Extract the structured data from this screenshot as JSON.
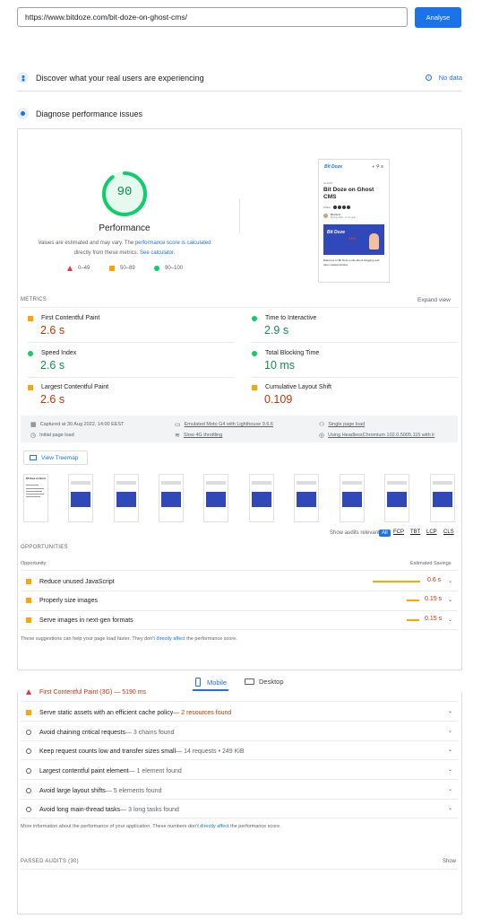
{
  "url_bar": {
    "value": "https://www.bitdoze.com/bit-doze-on-ghost-cms/",
    "button": "Analyse"
  },
  "field_data": {
    "title": "Discover what your real users are experiencing",
    "status": "No data"
  },
  "lab": {
    "title": "Diagnose performance issues"
  },
  "score": {
    "value": "90",
    "fraction": 0.9,
    "label": "Performance",
    "note_pre": "Values are estimated and may vary. The ",
    "note_link1": "performance score is calculated",
    "note_mid": " directly from these metrics. ",
    "note_link2": "See calculator.",
    "legend": [
      "0–49",
      "50–89",
      "90–100"
    ],
    "color": "#0cce6b"
  },
  "preview": {
    "brand": "Bit Doze",
    "tag": "GHOST",
    "title": "Bit Doze on Ghost CMS",
    "share": "Share",
    "author": "Bit Doze",
    "meta": "28 Aug 2022 · 3 min read",
    "hero": "Bit Doze",
    "hero_sub": "CMS",
    "body": "Welcome to Bit Doze a site about blogging and other related articles."
  },
  "metrics": {
    "header": "METRICS",
    "expand": "Expand view",
    "items": [
      {
        "name": "First Contentful Paint",
        "value": "2.6 s",
        "status": "average"
      },
      {
        "name": "Time to Interactive",
        "value": "2.9 s",
        "status": "good"
      },
      {
        "name": "Speed Index",
        "value": "2.6 s",
        "status": "good"
      },
      {
        "name": "Total Blocking Time",
        "value": "10 ms",
        "status": "good"
      },
      {
        "name": "Largest Contentful Paint",
        "value": "2.6 s",
        "status": "average"
      },
      {
        "name": "Cumulative Layout Shift",
        "value": "0.109",
        "status": "average"
      }
    ]
  },
  "runtime": {
    "captured": "Captured at 30 Aug 2022, 14:00 EEST",
    "initial": "Initial page load",
    "device": "Emulated Moto G4 with Lighthouse 9.6.6",
    "throttle": "Slow 4G throttling",
    "session": "Single page load",
    "browser": "Using HeadlessChromium 102.0.5005.115 with lr"
  },
  "treemap": "View Treemap",
  "filter": {
    "label": "Show audits relevant to:",
    "options": [
      "All",
      "FCP",
      "TBT",
      "LCP",
      "CLS"
    ]
  },
  "opportunities": {
    "header": "OPPORTUNITIES",
    "col1": "Opportunity",
    "col2": "Estimated Savings",
    "items": [
      {
        "title": "Reduce unused JavaScript",
        "saving": "0.6 s",
        "fraction": 0.6
      },
      {
        "title": "Properly size images",
        "saving": "0.15 s",
        "fraction": 0.15
      },
      {
        "title": "Serve images in next-gen formats",
        "saving": "0.15 s",
        "fraction": 0.15
      }
    ],
    "footer_pre": "These suggestions can help your page load faster. They don't ",
    "footer_link": "directly affect",
    "footer_post": " the performance score."
  },
  "tabs": {
    "mobile": "Mobile",
    "desktop": "Desktop"
  },
  "diagnostics": {
    "partial": "First Contentful Paint (3G) — 5190 ms",
    "items": [
      {
        "title": "Serve static assets with an efficient cache policy",
        "detail": " — 2 resources found",
        "kind": "warn"
      },
      {
        "title": "Avoid chaining critical requests",
        "detail": " — 3 chains found",
        "kind": "info"
      },
      {
        "title": "Keep request counts low and transfer sizes small",
        "detail": " — 14 requests • 249 KiB",
        "kind": "info"
      },
      {
        "title": "Largest contentful paint element",
        "detail": " — 1 element found",
        "kind": "info"
      },
      {
        "title": "Avoid large layout shifts",
        "detail": " — 5 elements found",
        "kind": "info"
      },
      {
        "title": "Avoid long main-thread tasks",
        "detail": " — 3 long tasks found",
        "kind": "info"
      }
    ],
    "footer_pre": "More information about the performance of your application. These numbers don't ",
    "footer_link": "directly affect",
    "footer_post": " the performance score."
  },
  "passed": {
    "label": "PASSED AUDITS (30)",
    "action": "Show"
  }
}
